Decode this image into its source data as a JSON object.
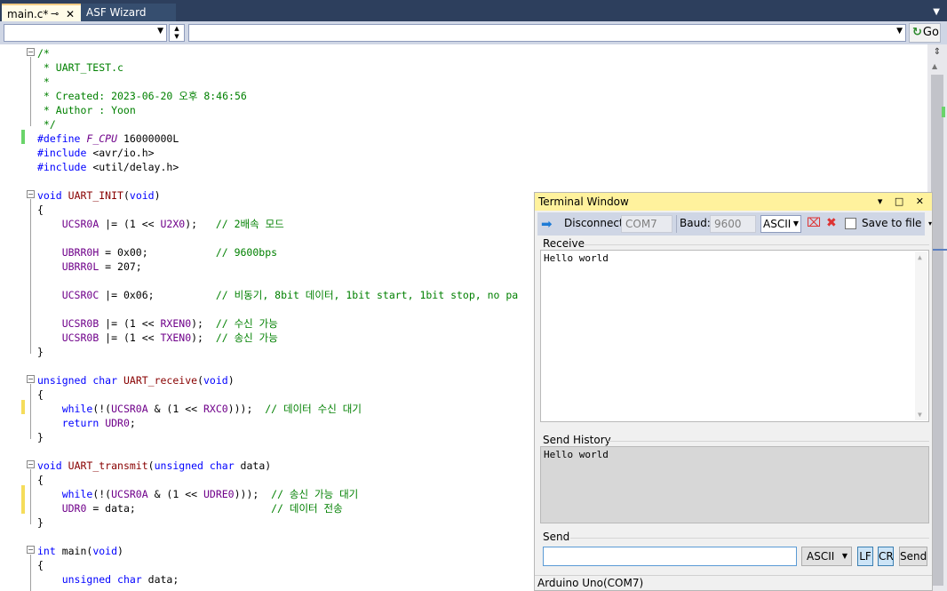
{
  "tabs": [
    {
      "label": "main.c*",
      "active": true
    },
    {
      "label": "ASF Wizard",
      "active": false
    }
  ],
  "tab_icons": {
    "pin": "⊸",
    "close": "✕"
  },
  "navbar": {
    "scope_value": "",
    "member_value": "",
    "go_label": "Go"
  },
  "code_lines": [
    "/*",
    " * UART_TEST.c",
    " *",
    " * Created: 2023-06-20 오후 8:46:56",
    " * Author : Yoon",
    " */",
    "#define F_CPU 16000000L",
    "#include <avr/io.h>",
    "#include <util/delay.h>",
    "",
    "void UART_INIT(void)",
    "{",
    "    UCSR0A |= (1 << U2X0);   // 2배속 모드",
    "",
    "    UBRR0H = 0x00;           // 9600bps",
    "    UBRR0L = 207;",
    "",
    "    UCSR0C |= 0x06;          // 비동기, 8bit 데이터, 1bit start, 1bit stop, no pa",
    "",
    "    UCSR0B |= (1 << RXEN0);  // 수신 가능",
    "    UCSR0B |= (1 << TXEN0);  // 송신 가능",
    "}",
    "",
    "unsigned char UART_receive(void)",
    "{",
    "    while(!(UCSR0A & (1 << RXC0)));  // 데이터 수신 대기",
    "    return UDR0;",
    "}",
    "",
    "void UART_transmit(unsigned char data)",
    "{",
    "    while(!(UCSR0A & (1 << UDRE0)));  // 송신 가능 대기",
    "    UDR0 = data;                      // 데이터 전송",
    "}",
    "",
    "int main(void)",
    "{",
    "    unsigned char data;"
  ],
  "terminal": {
    "title": "Terminal Window",
    "title_buttons": "▾ □ ✕",
    "disconnect_label": "Disconnect",
    "port": "COM7",
    "baud_label": "Baud:",
    "baud": "9600",
    "encoding": "ASCII",
    "save_to_file_label": "Save to file",
    "receive_label": "Receive",
    "receive_text": "Hello world",
    "send_history_label": "Send History",
    "send_history_text": "Hello world",
    "send_label": "Send",
    "send_input_value": "",
    "send_encoding": "ASCII",
    "lf_label": "LF",
    "cr_label": "CR",
    "send_button_label": "Send",
    "status": "Arduino Uno(COM7)"
  },
  "colors": {
    "keyword": "#0000ff",
    "comment": "#008000",
    "macro": "#6f008a",
    "function": "#880000",
    "terminal_title_bg": "#fff29d",
    "change_saved": "#6ad46a",
    "change_unsaved": "#f5dc5a"
  }
}
